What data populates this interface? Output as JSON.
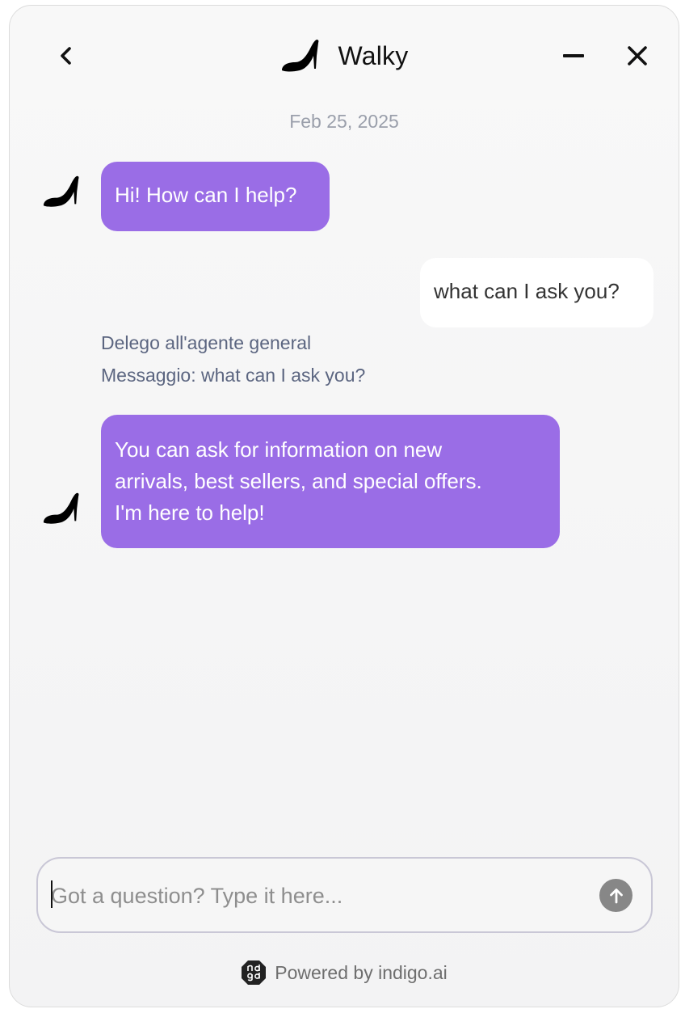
{
  "header": {
    "title": "Walky",
    "back_icon": "chevron-left-icon",
    "logo_icon": "high-heel-icon",
    "minimize_icon": "minimize-icon",
    "close_icon": "close-icon"
  },
  "conversation": {
    "date": "Feb 25, 2025",
    "messages": [
      {
        "role": "bot",
        "text": "Hi! How can I help?"
      },
      {
        "role": "user",
        "text": "what can I ask you?"
      },
      {
        "role": "system",
        "lines": [
          "Delego all'agente general",
          "Messaggio: what can I ask you?"
        ]
      },
      {
        "role": "bot",
        "lines": [
          "You can ask for information on new",
          "arrivals, best sellers, and special offers.",
          "I'm here to help!"
        ]
      }
    ]
  },
  "composer": {
    "placeholder": "Got a question? Type it here...",
    "value": "",
    "send_icon": "arrow-up-icon"
  },
  "footer": {
    "text": "Powered by indigo.ai",
    "logo_icon": "indigo-logo-icon"
  },
  "colors": {
    "bot_bubble": "#9a6de6",
    "user_bubble": "#ffffff",
    "meta_text": "#5b6580",
    "date_text": "#9a9fab"
  }
}
